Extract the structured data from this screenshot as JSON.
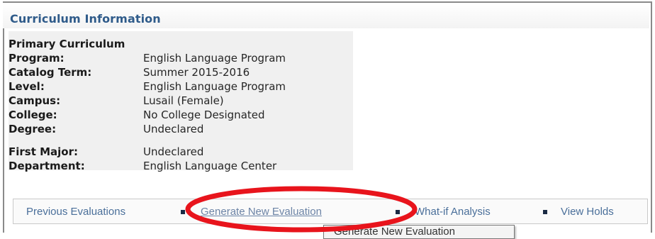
{
  "section": {
    "title": "Curriculum Information"
  },
  "primary": {
    "heading": "Primary Curriculum",
    "rows": [
      {
        "label": "Program:",
        "value": "English Language Program"
      },
      {
        "label": "Catalog Term:",
        "value": "Summer 2015-2016"
      },
      {
        "label": "Level:",
        "value": "English Language Program"
      },
      {
        "label": "Campus:",
        "value": "Lusail (Female)"
      },
      {
        "label": "College:",
        "value": "No College Designated"
      },
      {
        "label": "Degree:",
        "value": "Undeclared"
      }
    ]
  },
  "major": {
    "rows": [
      {
        "label": "First Major:",
        "value": "Undeclared"
      },
      {
        "label": "Department:",
        "value": "English Language Center"
      }
    ]
  },
  "footer": {
    "links": [
      {
        "label": "Previous Evaluations"
      },
      {
        "label": "Generate New Evaluation"
      },
      {
        "label": "What-if Analysis"
      },
      {
        "label": "View Holds"
      }
    ]
  },
  "tooltip": {
    "text": "Generate New Evaluation"
  },
  "colors": {
    "title": "#2f5b8a",
    "link": "#4a6f9a",
    "panel": "#f0f0f0",
    "annotation": "#e8141c"
  },
  "annotation": {
    "shape": "red-ellipse",
    "highlights": "Generate New Evaluation"
  }
}
